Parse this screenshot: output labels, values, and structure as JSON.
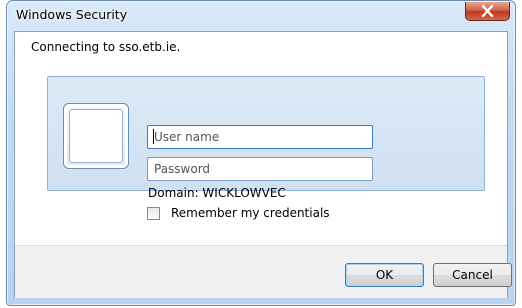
{
  "window": {
    "title": "Windows Security"
  },
  "message": {
    "connecting": "Connecting to sso.etb.ie."
  },
  "credentials": {
    "username_placeholder": "User name",
    "password_placeholder": "Password",
    "domain": "Domain: WICKLOWVEC",
    "remember_label": "Remember my credentials",
    "remember_checked": false
  },
  "buttons": {
    "ok": "OK",
    "cancel": "Cancel"
  },
  "icons": {
    "close": "close-icon",
    "user_tile": "user-tile-icon"
  },
  "colors": {
    "frame": "#c2dbf2",
    "close_button": "#c0381d",
    "credential_panel": "#dde9f6",
    "footer": "#f0f0f0"
  }
}
